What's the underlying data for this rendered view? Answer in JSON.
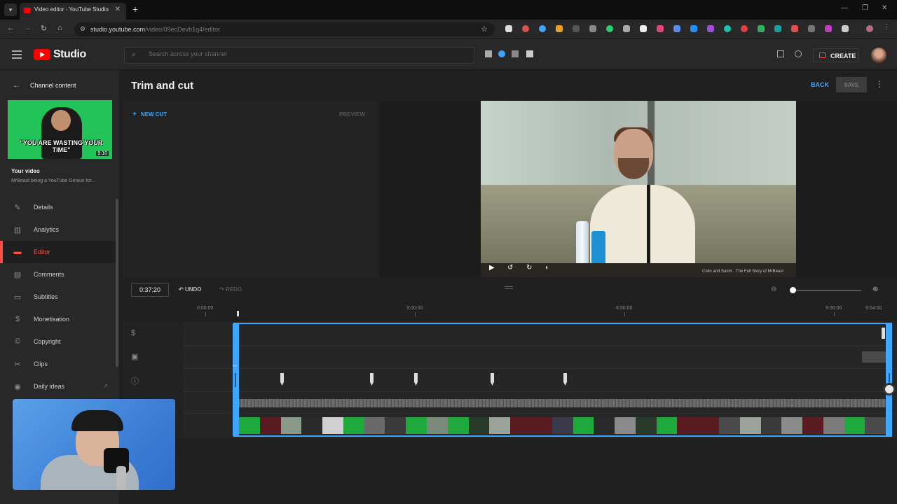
{
  "browser": {
    "tab_title": "Video editor - YouTube Studio",
    "url_host": "studio.youtube.com",
    "url_path": "/video/09ecDevb1q4/editor"
  },
  "header": {
    "logo_text": "Studio",
    "search_placeholder": "Search across your channel",
    "create_label": "CREATE"
  },
  "sidebar": {
    "back_label": "Channel content",
    "thumbnail_caption": "\"YOU ARE WASTING YOUR TIME\"",
    "thumbnail_duration": "9:10",
    "your_video_label": "Your video",
    "video_title": "MrBeast being a YouTube Genius for...",
    "items": [
      {
        "label": "Details",
        "icon": "pencil-icon"
      },
      {
        "label": "Analytics",
        "icon": "analytics-icon"
      },
      {
        "label": "Editor",
        "icon": "editor-icon",
        "active": true
      },
      {
        "label": "Comments",
        "icon": "comments-icon"
      },
      {
        "label": "Subtitles",
        "icon": "subtitles-icon"
      },
      {
        "label": "Monetisation",
        "icon": "dollar-icon"
      },
      {
        "label": "Copyright",
        "icon": "copyright-icon"
      },
      {
        "label": "Clips",
        "icon": "scissors-icon"
      },
      {
        "label": "Daily ideas",
        "icon": "ideas-icon"
      }
    ]
  },
  "editor": {
    "page_title": "Trim and cut",
    "back_label": "BACK",
    "save_label": "SAVE",
    "new_cut_label": "NEW CUT",
    "preview_label": "PREVIEW",
    "video_caption": "Colin and Samir · The Full Story of MrBeast"
  },
  "timeline": {
    "current_time": "0:37:20",
    "undo_label": "UNDO",
    "redo_label": "REDO",
    "ruler": [
      "0:00:00",
      "3:00:00",
      "6:00:00",
      "9:00:00",
      "9:54:00"
    ],
    "accent_color": "#3ea6ff"
  },
  "colors": {
    "brand_red": "#ff0000",
    "active_nav": "#ff4e45",
    "link_blue": "#3ea6ff"
  }
}
